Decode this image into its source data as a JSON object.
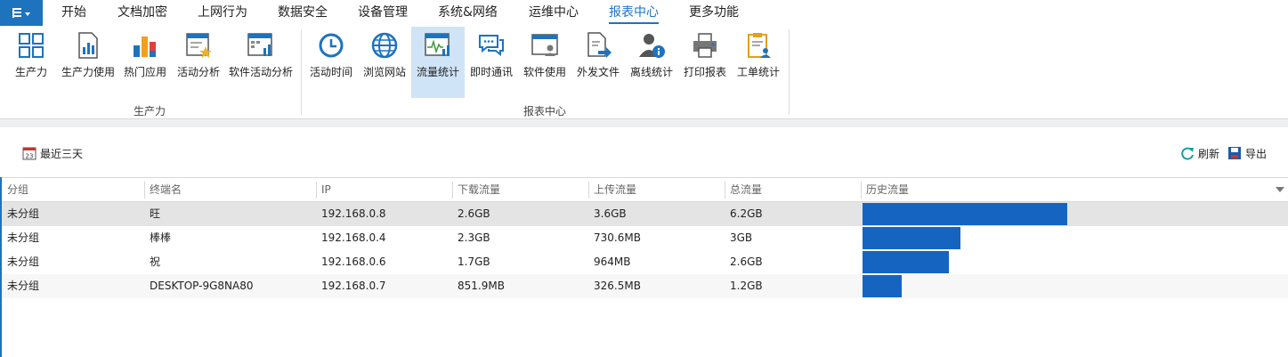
{
  "menu": {
    "items": [
      "开始",
      "文档加密",
      "上网行为",
      "数据安全",
      "设备管理",
      "系统&网络",
      "运维中心",
      "报表中心",
      "更多功能"
    ],
    "active": "报表中心"
  },
  "ribbon": {
    "groups": [
      {
        "label": "生产力",
        "buttons": [
          {
            "label": "生产力",
            "icon": "productivity-grid-icon"
          },
          {
            "label": "生产力使用",
            "icon": "productivity-chart-icon"
          },
          {
            "label": "热门应用",
            "icon": "popular-apps-icon"
          },
          {
            "label": "活动分析",
            "icon": "activity-analysis-icon"
          },
          {
            "label": "软件活动分析",
            "icon": "software-activity-icon"
          }
        ]
      },
      {
        "label": "报表中心",
        "buttons": [
          {
            "label": "活动时间",
            "icon": "clock-icon"
          },
          {
            "label": "浏览网站",
            "icon": "globe-icon"
          },
          {
            "label": "流量统计",
            "icon": "traffic-stats-icon"
          },
          {
            "label": "即时通讯",
            "icon": "chat-bubbles-icon"
          },
          {
            "label": "软件使用",
            "icon": "software-window-icon"
          },
          {
            "label": "外发文件",
            "icon": "outgoing-file-icon"
          },
          {
            "label": "离线统计",
            "icon": "offline-user-icon"
          },
          {
            "label": "打印报表",
            "icon": "printer-icon"
          },
          {
            "label": "工单统计",
            "icon": "work-order-clipboard-icon"
          }
        ]
      }
    ],
    "selected": "流量统计"
  },
  "toolbar": {
    "date_range": "最近三天",
    "date_icon_text": "23",
    "refresh": "刷新",
    "export": "导出"
  },
  "table": {
    "columns": [
      "分组",
      "终端名",
      "IP",
      "下载流量",
      "上传流量",
      "总流量",
      "历史流量"
    ],
    "rows": [
      {
        "group": "未分组",
        "name": "旺",
        "ip": "192.168.0.8",
        "download": "2.6GB",
        "upload": "3.6GB",
        "total": "6.2GB",
        "history": 1.0
      },
      {
        "group": "未分组",
        "name": "棒棒",
        "ip": "192.168.0.4",
        "download": "2.3GB",
        "upload": "730.6MB",
        "total": "3GB",
        "history": 0.48
      },
      {
        "group": "未分组",
        "name": "祝",
        "ip": "192.168.0.6",
        "download": "1.7GB",
        "upload": "964MB",
        "total": "2.6GB",
        "history": 0.42
      },
      {
        "group": "未分组",
        "name": "DESKTOP-9G8NA80",
        "ip": "192.168.0.7",
        "download": "851.9MB",
        "upload": "326.5MB",
        "total": "1.2GB",
        "history": 0.19
      }
    ],
    "selected_row": 0
  },
  "colors": {
    "accent": "#1e73be",
    "bar": "#1565c0",
    "selection": "#cfe4f7"
  }
}
